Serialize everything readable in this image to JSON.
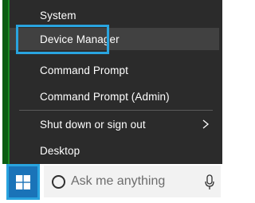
{
  "menu": {
    "items": [
      {
        "label": "System"
      },
      {
        "label": "Device Manager"
      },
      {
        "label": "Command Prompt"
      },
      {
        "label": "Command Prompt (Admin)"
      },
      {
        "label": "Shut down or sign out"
      },
      {
        "label": "Desktop"
      }
    ],
    "highlighted_item": "Device Manager"
  },
  "taskbar": {
    "start_icon": "windows-logo-icon",
    "search_placeholder": "Ask me anything",
    "search_icon": "cortana-ring-icon",
    "mic_icon": "microphone-icon"
  },
  "colors": {
    "menu_bg": "#2b2b2b",
    "highlight_border": "#29a4df",
    "start_bg": "#1a73b8"
  }
}
